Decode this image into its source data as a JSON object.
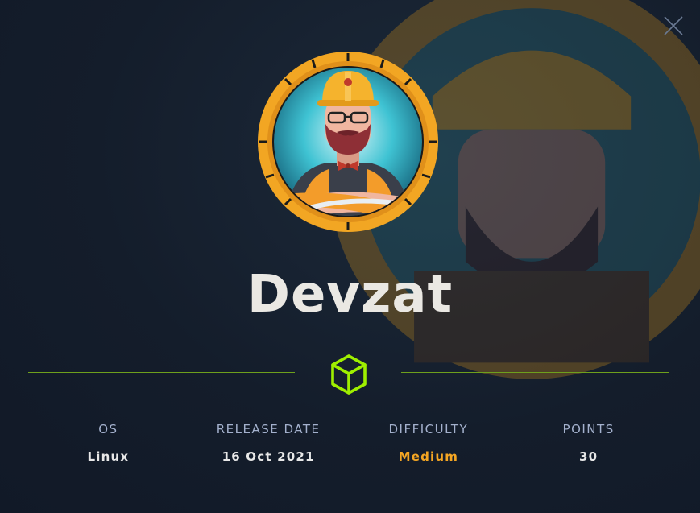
{
  "modal": {
    "machine_name": "Devzat",
    "close_icon": "close-icon",
    "category_icon": "box-icon",
    "accent_color": "#9fef00",
    "difficulty_color": "#f5a623"
  },
  "stats": [
    {
      "label": "OS",
      "value": "Linux"
    },
    {
      "label": "RELEASE DATE",
      "value": "16 Oct 2021"
    },
    {
      "label": "DIFFICULTY",
      "value": "Medium"
    },
    {
      "label": "POINTS",
      "value": "30"
    }
  ]
}
